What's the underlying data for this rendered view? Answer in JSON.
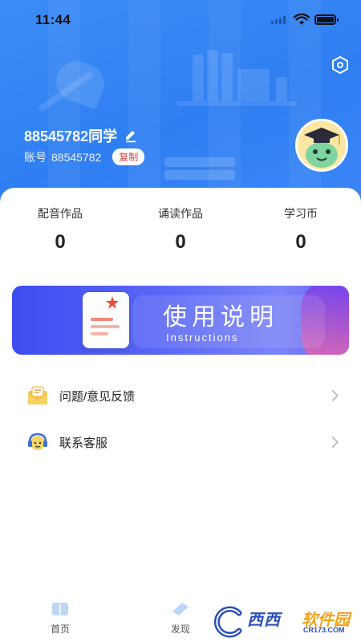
{
  "status_bar": {
    "time": "11:44"
  },
  "profile": {
    "username": "88545782同学",
    "account_label": "账号",
    "account_id": "88545782",
    "copy_label": "复制"
  },
  "stats": [
    {
      "label": "配音作品",
      "value": "0"
    },
    {
      "label": "诵读作品",
      "value": "0"
    },
    {
      "label": "学习币",
      "value": "0"
    }
  ],
  "banner": {
    "title": "使用说明",
    "subtitle": "Instructions"
  },
  "menu": [
    {
      "label": "问题/意见反馈",
      "icon": "feedback-envelope-icon"
    },
    {
      "label": "联系客服",
      "icon": "customer-service-icon"
    }
  ],
  "tabbar": [
    {
      "label": "首页",
      "icon": "home-book-icon"
    },
    {
      "label": "发现",
      "icon": "discover-icon"
    }
  ],
  "watermark": {
    "brand_a": "西西",
    "brand_b": "软件园",
    "url": "CR173.COM"
  },
  "colors": {
    "header_blue": "#3b8cf6",
    "banner_purple": "#4f5bf3",
    "copy_red": "#e23b3b"
  }
}
